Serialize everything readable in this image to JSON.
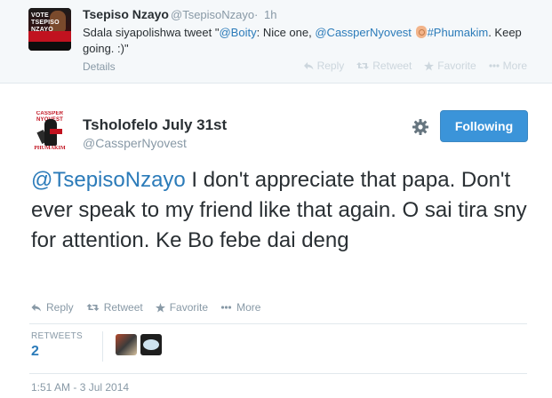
{
  "parent_tweet": {
    "avatar_text": "VOTE TSEPISO NZAYO",
    "name": "Tsepiso Nzayo",
    "handle": "@TsepisoNzayo",
    "separator": "·",
    "time": "1h",
    "text_part1": "Sdala siyapolishwa tweet \"",
    "mention1": "@Boity",
    "text_part2": ": Nice one, ",
    "mention2": "@CassperNyovest",
    "hashtag": "#Phumakim",
    "text_part3": ". Keep going. :)\"",
    "details_label": "Details",
    "actions": {
      "reply": "Reply",
      "retweet": "Retweet",
      "favorite": "Favorite",
      "more": "More"
    }
  },
  "main_tweet": {
    "avatar_top_text": "CASSPER NYOVEST",
    "avatar_bottom_text": "PHUMAKIM",
    "name": "Tsholofelo July 31st",
    "handle": "@CassperNyovest",
    "follow_button": "Following",
    "mention": "@TsepisoNzayo",
    "text": " I don't appreciate that papa. Don't ever speak to my friend like that again. O sai tira sny for attention. Ke Bo febe dai deng",
    "actions": {
      "reply": "Reply",
      "retweet": "Retweet",
      "favorite": "Favorite",
      "more": "More"
    },
    "retweets_label": "RETWEETS",
    "retweets_count": "2",
    "date": "1:51 AM - 3 Jul 2014"
  },
  "icons": {
    "reply": "reply-icon",
    "retweet": "retweet-icon",
    "favorite": "star-icon",
    "more": "ellipsis-icon",
    "settings": "gear-icon"
  },
  "colors": {
    "link": "#2b7bb9",
    "follow_button": "#3b94d9",
    "muted": "#8899a6",
    "parent_bg": "#f5f8fa"
  }
}
